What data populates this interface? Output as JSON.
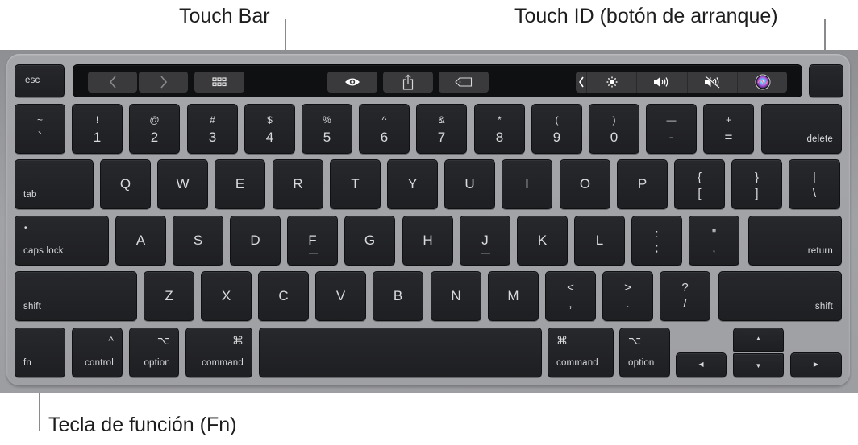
{
  "callouts": {
    "touch_bar": "Touch Bar",
    "touch_id": "Touch ID (botón de arranque)",
    "fn_key": "Tecla de función (Fn)"
  },
  "touch_bar": {
    "buttons": [
      {
        "name": "back",
        "icon": "chevron-left-icon",
        "glyph": "‹"
      },
      {
        "name": "forward",
        "icon": "chevron-right-icon",
        "glyph": "›"
      },
      {
        "name": "show-all-tabs",
        "icon": "grid-icon"
      },
      {
        "name": "reader",
        "icon": "eye-icon"
      },
      {
        "name": "share",
        "icon": "share-icon"
      },
      {
        "name": "tag",
        "icon": "tag-icon"
      }
    ],
    "control_strip": [
      {
        "name": "expand",
        "icon": "chevron-left-icon",
        "glyph": "❮"
      },
      {
        "name": "brightness",
        "icon": "brightness-icon"
      },
      {
        "name": "volume",
        "icon": "speaker-icon"
      },
      {
        "name": "mute",
        "icon": "mute-icon"
      },
      {
        "name": "siri",
        "icon": "siri-icon"
      }
    ]
  },
  "keys": {
    "esc": "esc",
    "number_row": [
      {
        "top": "~",
        "bottom": "`"
      },
      {
        "top": "!",
        "bottom": "1"
      },
      {
        "top": "@",
        "bottom": "2"
      },
      {
        "top": "#",
        "bottom": "3"
      },
      {
        "top": "$",
        "bottom": "4"
      },
      {
        "top": "%",
        "bottom": "5"
      },
      {
        "top": "^",
        "bottom": "6"
      },
      {
        "top": "&",
        "bottom": "7"
      },
      {
        "top": "*",
        "bottom": "8"
      },
      {
        "top": "(",
        "bottom": "9"
      },
      {
        "top": ")",
        "bottom": "0"
      },
      {
        "top": "—",
        "bottom": "-"
      },
      {
        "top": "+",
        "bottom": "="
      }
    ],
    "delete": "delete",
    "tab": "tab",
    "qwerty_row": [
      "Q",
      "W",
      "E",
      "R",
      "T",
      "Y",
      "U",
      "I",
      "O",
      "P"
    ],
    "brackets": [
      {
        "top": "{",
        "bottom": "["
      },
      {
        "top": "}",
        "bottom": "]"
      },
      {
        "top": "|",
        "bottom": "\\"
      }
    ],
    "caps_lock": "caps lock",
    "caps_dot": "•",
    "home_row": [
      "A",
      "S",
      "D",
      "F",
      "G",
      "H",
      "J",
      "K",
      "L"
    ],
    "home_punct": [
      {
        "top": ":",
        "bottom": ";"
      },
      {
        "top": "\"",
        "bottom": ","
      }
    ],
    "return": "return",
    "shift_left": "shift",
    "bottom_letters": [
      "Z",
      "X",
      "C",
      "V",
      "B",
      "N",
      "M"
    ],
    "bottom_punct": [
      {
        "top": "<",
        "bottom": ","
      },
      {
        "top": ">",
        "bottom": "."
      },
      {
        "top": "?",
        "bottom": "/"
      }
    ],
    "shift_right": "shift",
    "fn": "fn",
    "control": {
      "label": "control",
      "symbol": "^"
    },
    "option_left": {
      "label": "option",
      "symbol": "⌥"
    },
    "command_left": {
      "label": "command",
      "symbol": "⌘"
    },
    "command_right": {
      "label": "command",
      "symbol": "⌘"
    },
    "option_right": {
      "label": "option",
      "symbol": "⌥"
    },
    "arrows": {
      "left": "◀",
      "up": "▲",
      "down": "▼",
      "right": "▶"
    }
  }
}
